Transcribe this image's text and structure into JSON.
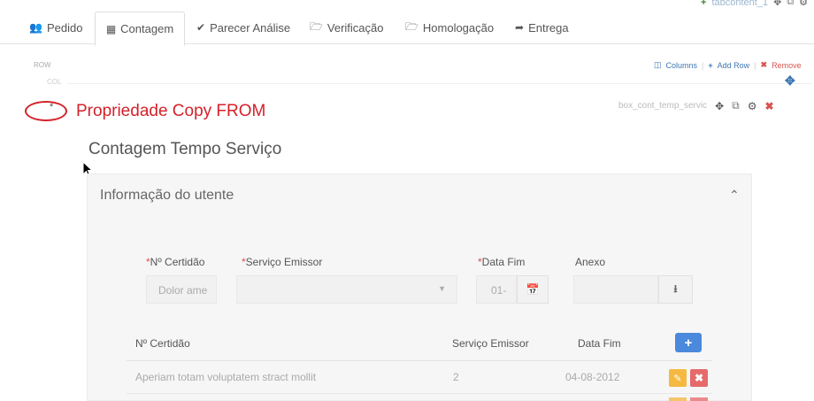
{
  "tabs": [
    {
      "label": "Pedido",
      "icon": "users-icon"
    },
    {
      "label": "Contagem",
      "icon": "calculator-icon"
    },
    {
      "label": "Parecer Análise",
      "icon": "check-icon"
    },
    {
      "label": "Verificação",
      "icon": "folder-open-icon"
    },
    {
      "label": "Homologação",
      "icon": "folder-open-icon"
    },
    {
      "label": "Entrega",
      "icon": "paper-plane-icon"
    }
  ],
  "top_right": {
    "label": "tabcontent_1"
  },
  "builder": {
    "row_label": "ROW",
    "col_label": "COL",
    "columns_label": "Columns",
    "add_row_label": "Add Row",
    "remove_label": "Remove",
    "asterisk": "*",
    "component_name": "box_cont_temp_servic"
  },
  "annotation": {
    "text": "Propriedade Copy FROM"
  },
  "section": {
    "title": "Contagem Tempo Serviço"
  },
  "panel": {
    "title": "Informação do utente",
    "form": {
      "certidao_label": "Nº Certidão",
      "servico_label": "Serviço Emissor",
      "data_fim_label": "Data Fim",
      "anexo_label": "Anexo",
      "certidao_value": "Dolor ame",
      "data_fim_value": "01-"
    },
    "table": {
      "headers": [
        "Nº Certidão",
        "Serviço Emissor",
        "Data Fim"
      ],
      "rows": [
        [
          "Aperiam totam voluptatem stract mollit",
          "2",
          "04-08-2012"
        ]
      ]
    }
  },
  "colors": {
    "accent": "#4a89dc",
    "annotation": "#d4212a",
    "required": "#d9534f",
    "edit": "#f5b942",
    "delete": "#e56a6a"
  }
}
